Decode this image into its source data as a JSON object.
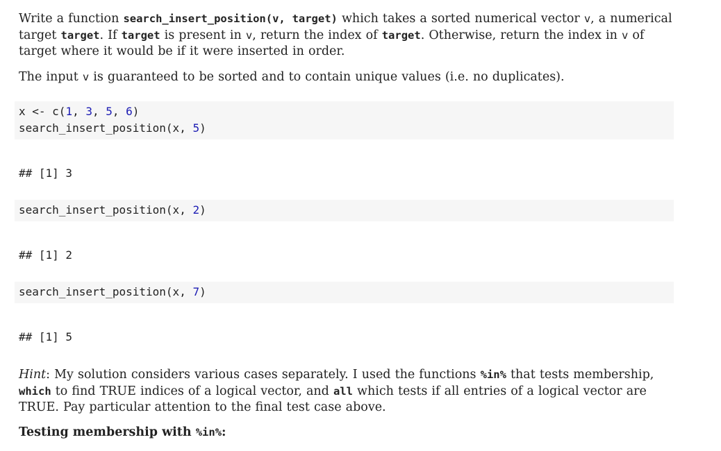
{
  "intro": {
    "p1": {
      "t1": "Write a function ",
      "c1": "search_insert_position(v, target)",
      "t2": " which takes a sorted numerical vector ",
      "c2": "v",
      "t3": ", a numerical target ",
      "c3": "target",
      "t4": ". If ",
      "c4": "target",
      "t5": " is present in ",
      "c5": "v",
      "t6": ", return the index of ",
      "c6": "target",
      "t7": ". Otherwise, return the index in ",
      "c7": "v",
      "t8": " of target where it would be if it were inserted in order."
    },
    "p2": {
      "t1": "The input ",
      "c1": "v",
      "t2": " is guaranteed to be sorted and to contain unique values (i.e. no duplicates)."
    }
  },
  "code_block_1": {
    "line1": {
      "a": "x <- c(",
      "n1": "1",
      "s1": ", ",
      "n2": "3",
      "s2": ", ",
      "n3": "5",
      "s3": ", ",
      "n4": "6",
      "b": ")"
    },
    "line2": {
      "a": "search_insert_position(x, ",
      "n1": "5",
      "b": ")"
    }
  },
  "output_1": "## [1] 3",
  "code_block_2": {
    "a": "search_insert_position(x, ",
    "n1": "2",
    "b": ")"
  },
  "output_2": "## [1] 2",
  "code_block_3": {
    "a": "search_insert_position(x, ",
    "n1": "7",
    "b": ")"
  },
  "output_3": "## [1] 5",
  "hint": {
    "label": "Hint",
    "t1": ": My solution considers various cases separately. I used the functions ",
    "c1": "%in%",
    "t2": " that tests membership, ",
    "c2": "which",
    "t3": " to find TRUE indices of a logical vector, and ",
    "c3": "all",
    "t4": " which tests if all entries of a logical vector are TRUE. Pay particular attention to the final test case above."
  },
  "heading": {
    "text": "Testing membership with ",
    "code": "%in%",
    "suffix": ":"
  }
}
